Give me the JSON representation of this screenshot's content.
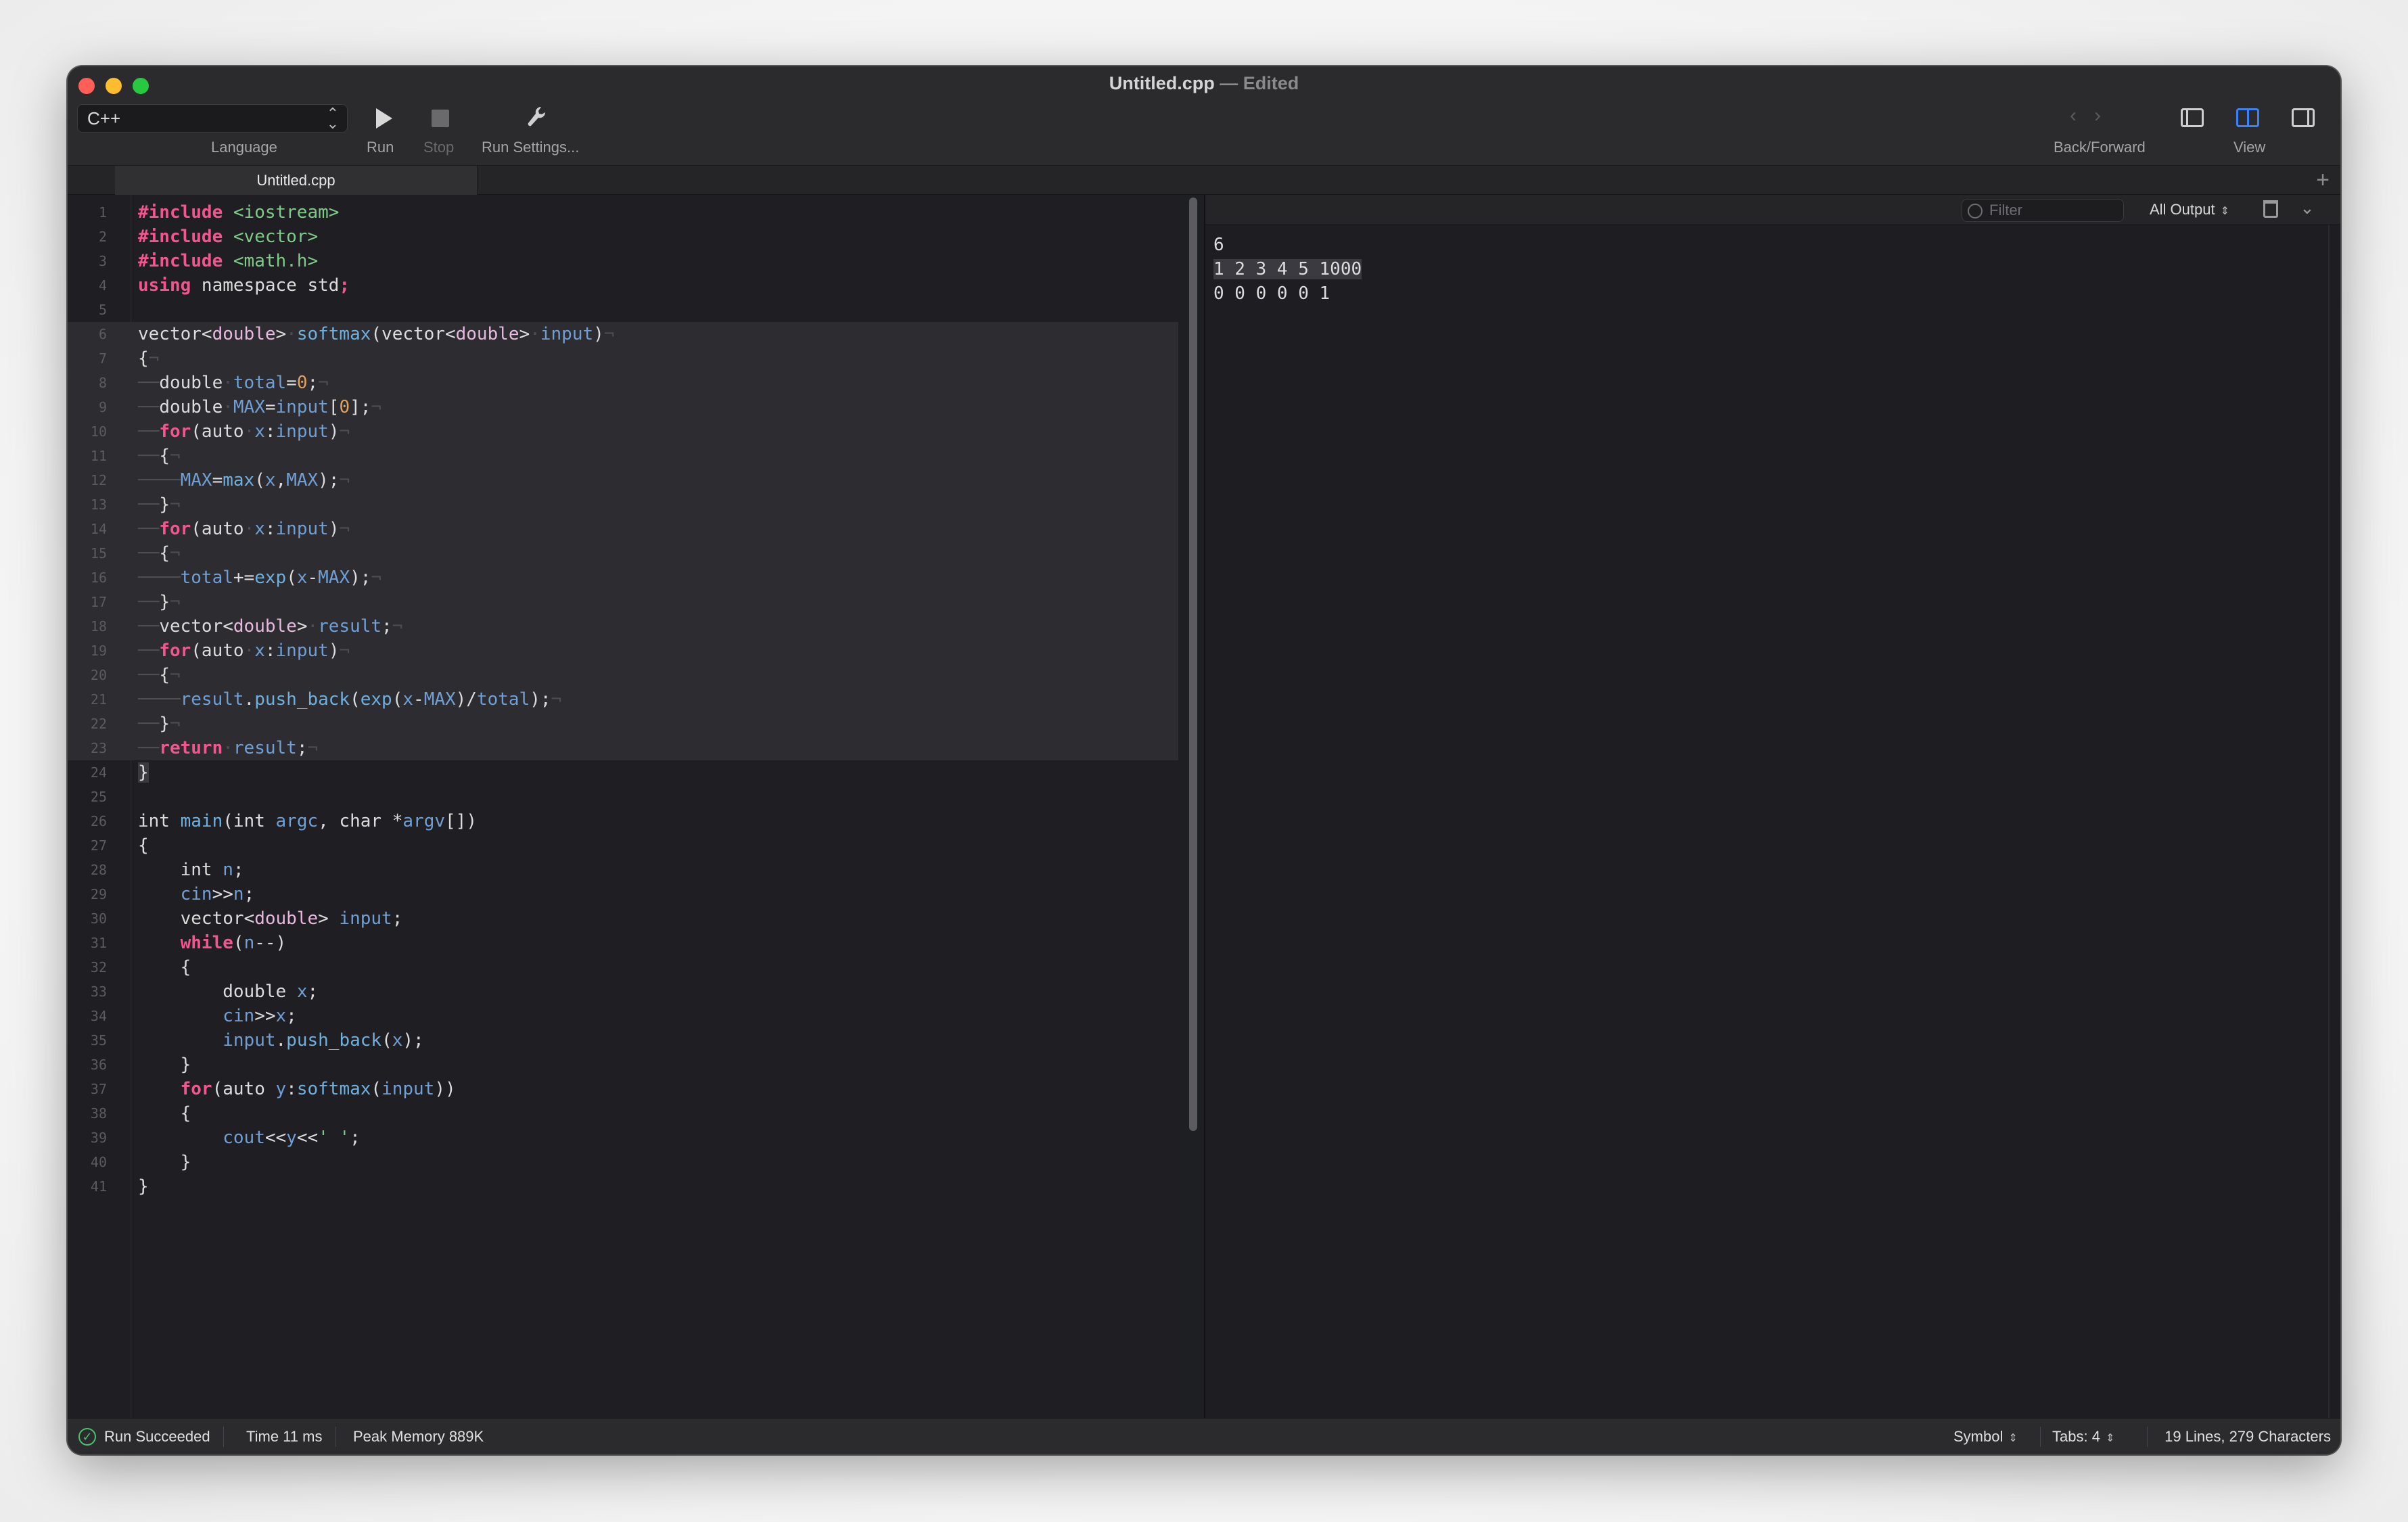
{
  "window": {
    "title": "Untitled.cpp",
    "title_separator": "—",
    "status": "Edited"
  },
  "toolbar": {
    "language_value": "C++",
    "language_label": "Language",
    "run_label": "Run",
    "stop_label": "Stop",
    "run_settings_label": "Run Settings...",
    "back_forward_label": "Back/Forward",
    "view_label": "View"
  },
  "tabs": [
    {
      "label": "Untitled.cpp"
    }
  ],
  "editor": {
    "lines": [
      "1",
      "2",
      "3",
      "4",
      "5",
      "6",
      "7",
      "8",
      "9",
      "10",
      "11",
      "12",
      "13",
      "14",
      "15",
      "16",
      "17",
      "18",
      "19",
      "20",
      "21",
      "22",
      "23",
      "24",
      "25",
      "26",
      "27",
      "28",
      "29",
      "30",
      "31",
      "32",
      "33",
      "34",
      "35",
      "36",
      "37",
      "38",
      "39",
      "40",
      "41"
    ],
    "code": [
      "#include <iostream>",
      "#include <vector>",
      "#include <math.h>",
      "using namespace std;",
      "",
      "vector<double> softmax(vector<double> input)",
      "{",
      "    double total=0;",
      "    double MAX=input[0];",
      "    for(auto x:input)",
      "    {",
      "        MAX=max(x,MAX);",
      "    }",
      "    for(auto x:input)",
      "    {",
      "        total+=exp(x-MAX);",
      "    }",
      "    vector<double> result;",
      "    for(auto x:input)",
      "    {",
      "        result.push_back(exp(x-MAX)/total);",
      "    }",
      "    return result;",
      "}",
      "",
      "int main(int argc, char *argv[])",
      "{",
      "    int n;",
      "    cin>>n;",
      "    vector<double> input;",
      "    while(n--)",
      "    {",
      "        double x;",
      "        cin>>x;",
      "        input.push_back(x);",
      "    }",
      "    for(auto y:softmax(input))",
      "    {",
      "        cout<<y<<' ';",
      "    }",
      "}"
    ]
  },
  "output": {
    "filter_placeholder": "Filter",
    "scope_value": "All Output",
    "lines": [
      "6",
      "1 2 3 4 5 1000",
      "0 0 0 0 0 1"
    ]
  },
  "statusbar": {
    "run_status": "Run Succeeded",
    "time": "Time 11 ms",
    "memory": "Peak Memory 889K",
    "symbol": "Symbol",
    "tabs": "Tabs: 4",
    "stats": "19 Lines, 279 Characters"
  },
  "colors": {
    "accent": "#3b82f6",
    "keyword": "#f2568f",
    "identifier": "#6fb0de",
    "string": "#7ecb88",
    "success": "#47c36b"
  }
}
